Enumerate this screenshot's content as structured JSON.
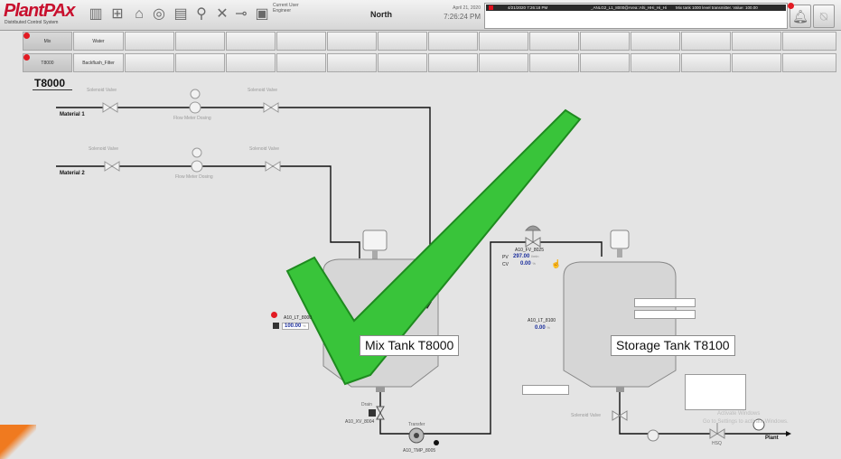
{
  "header": {
    "logo_brand": "PlantPAx",
    "logo_subtitle": "Distributed Control System",
    "user_label": "Current User",
    "user_name": "Engineer",
    "area": "North",
    "date": "April 21, 2020",
    "time": "7:26:24 PM",
    "alarm": {
      "timestamp": "4/21/2020 7:26:18 PM",
      "tag": "_ANLG2_L1_8000@Area::Ahi_HHi_Hi_Hi",
      "message": "Mix tank 1000 level transmitter. Value: 100.00"
    },
    "colors": {
      "alarm_red": "#e0101e",
      "brand_red": "#c8102e"
    }
  },
  "nav": {
    "row1": [
      "Mix",
      "Water"
    ],
    "row2": [
      "T8000",
      "Backflush_Filter"
    ]
  },
  "page_title": "T8000",
  "diagram": {
    "material1": "Material 1",
    "material2": "Material 2",
    "solenoid_valve": "Solenoid Valve",
    "flow_meter_dosing": "Flow Meter Dosing",
    "flow_meter_dosing2": "Flow Meter Dosing",
    "mix_tank": "Mix Tank T8000",
    "storage_tank": "Storage Tank T8100",
    "level_tag1": "A10_LT_8000",
    "level_pv1": "100.00",
    "level_unit1": "%",
    "level_tag2": "A10_LT_8100",
    "level_pv2": "0.00",
    "level_unit2": "%",
    "fv_tag": "A10_FV_8025",
    "fv_pv_label": "PV",
    "fv_pv": "297.00",
    "fv_pv_unit": "l/min",
    "fv_cv_label": "CV",
    "fv_cv": "0.00",
    "fv_cv_unit": "%",
    "drain_label": "Drain",
    "drain_valve_tag": "A10_XV_8004",
    "pump_label": "Transfer",
    "pump_tag": "A10_TMP_8005",
    "solenoid_valve_right": "Solenoid Valve",
    "hsq": "HSQ",
    "plant": "Plant",
    "watermark1": "Activate Windows",
    "watermark2": "Go to Settings to activate Windows."
  }
}
